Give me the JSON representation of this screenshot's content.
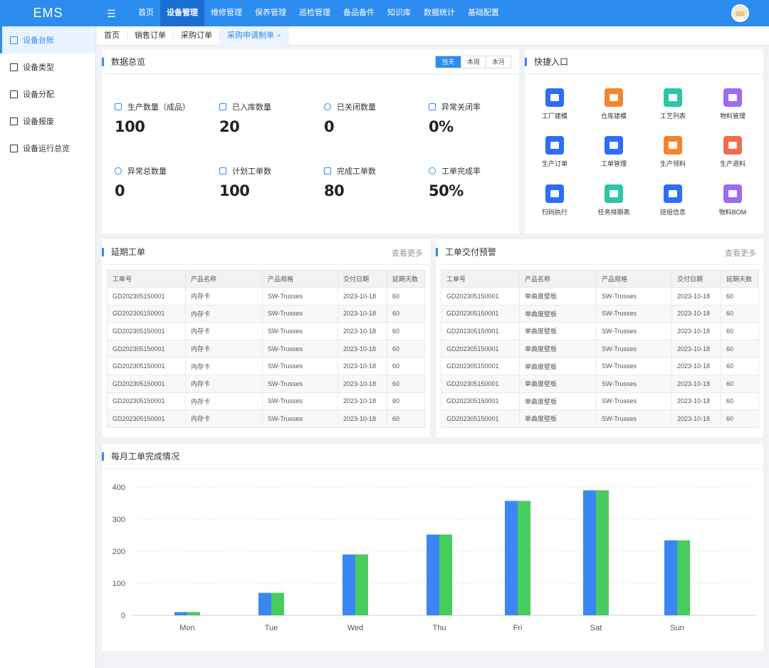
{
  "app": {
    "logo": "EMS"
  },
  "nav": [
    "首页",
    "设备管理",
    "维修管理",
    "保养管理",
    "巡检管理",
    "备品备件",
    "知识库",
    "数据统计",
    "基础配置"
  ],
  "sidebar": [
    "设备台账",
    "设备类型",
    "设备分配",
    "设备报废",
    "设备运行总览"
  ],
  "tabs": [
    {
      "label": "首页",
      "closable": false
    },
    {
      "label": "销售订单",
      "closable": false
    },
    {
      "label": "采购订单",
      "closable": false
    },
    {
      "label": "采购申请制单",
      "closable": true,
      "close": "×"
    }
  ],
  "overview": {
    "title": "数据总览",
    "ranges": [
      "当天",
      "本周",
      "本月"
    ],
    "stats": [
      {
        "label": "生产数量（成品）",
        "value": "100",
        "icon": "database-icon"
      },
      {
        "label": "已入库数量",
        "value": "20",
        "icon": "inbox-icon"
      },
      {
        "label": "已关闭数量",
        "value": "0",
        "icon": "close-circle-icon"
      },
      {
        "label": "异常关闭率",
        "value": "0%",
        "icon": "warning-icon"
      },
      {
        "label": "异常总数量",
        "value": "0",
        "icon": "bug-icon"
      },
      {
        "label": "计划工单数",
        "value": "100",
        "icon": "file-list-icon"
      },
      {
        "label": "完成工单数",
        "value": "80",
        "icon": "file-done-icon"
      },
      {
        "label": "工单完成率",
        "value": "50%",
        "icon": "check-circle-icon"
      }
    ]
  },
  "quick": {
    "title": "快捷入口",
    "items": [
      {
        "label": "工厂建模",
        "color": "#2d6ef5"
      },
      {
        "label": "仓库建模",
        "color": "#f5852d"
      },
      {
        "label": "工艺列表",
        "color": "#2ec4a8"
      },
      {
        "label": "物料管理",
        "color": "#9b6cf0"
      },
      {
        "label": "生产订单",
        "color": "#2d6ef5"
      },
      {
        "label": "工单管理",
        "color": "#2d6ef5"
      },
      {
        "label": "生产领料",
        "color": "#f5852d"
      },
      {
        "label": "生产退料",
        "color": "#f56a4d"
      },
      {
        "label": "扫码执行",
        "color": "#2d6ef5"
      },
      {
        "label": "任务排期表",
        "color": "#2ec4a8"
      },
      {
        "label": "班组信息",
        "color": "#2d6ef5"
      },
      {
        "label": "物料BOM",
        "color": "#9b6cf0"
      }
    ]
  },
  "delay": {
    "title": "延期工单",
    "more": "查看更多",
    "columns": [
      "工单号",
      "产品名称",
      "产品规格",
      "交付日期",
      "延期天数"
    ],
    "rows": [
      [
        "GD202305150001",
        "内存卡",
        "SW-Trusses",
        "2023-10-18",
        "60"
      ],
      [
        "GD202305150001",
        "内存卡",
        "SW-Trusses",
        "2023-10-18",
        "60"
      ],
      [
        "GD202305150001",
        "内存卡",
        "SW-Trusses",
        "2023-10-18",
        "60"
      ],
      [
        "GD202305150001",
        "内存卡",
        "SW-Trusses",
        "2023-10-18",
        "60"
      ],
      [
        "GD202305150001",
        "内存卡",
        "SW-Trusses",
        "2023-10-18",
        "60"
      ],
      [
        "GD202305150001",
        "内存卡",
        "SW-Trusses",
        "2023-10-18",
        "60"
      ],
      [
        "GD202305150001",
        "内存卡",
        "SW-Trusses",
        "2023-10-18",
        "60"
      ],
      [
        "GD202305150001",
        "内存卡",
        "SW-Trusses",
        "2023-10-18",
        "60"
      ]
    ]
  },
  "warning": {
    "title": "工单交付预警",
    "more": "查看更多",
    "columns": [
      "工单号",
      "产品名称",
      "产品规格",
      "交付日期",
      "延期天数"
    ],
    "rows": [
      [
        "GD202305150001",
        "单曲度壁板",
        "SW-Trusses",
        "2023-10-18",
        "60"
      ],
      [
        "GD202305150001",
        "单曲度壁板",
        "SW-Trusses",
        "2023-10-18",
        "60"
      ],
      [
        "GD202305150001",
        "单曲度壁板",
        "SW-Trusses",
        "2023-10-18",
        "60"
      ],
      [
        "GD202305150001",
        "单曲度壁板",
        "SW-Trusses",
        "2023-10-18",
        "60"
      ],
      [
        "GD202305150001",
        "单曲度壁板",
        "SW-Trusses",
        "2023-10-18",
        "60"
      ],
      [
        "GD202305150001",
        "单曲度壁板",
        "SW-Trusses",
        "2023-10-18",
        "60"
      ],
      [
        "GD202305150001",
        "单曲度壁板",
        "SW-Trusses",
        "2023-10-18",
        "60"
      ],
      [
        "GD202305150001",
        "单曲度壁板",
        "SW-Trusses",
        "2023-10-18",
        "60"
      ]
    ]
  },
  "monthly": {
    "title": "每月工单完成情况"
  },
  "chart_data": {
    "type": "bar",
    "title": "每月工单完成情况",
    "categories": [
      "Mon",
      "Tue",
      "Wed",
      "Thu",
      "Fri",
      "Sat",
      "Sun"
    ],
    "series": [
      {
        "values": [
          10,
          70,
          190,
          252,
          357,
          390,
          234
        ],
        "color": "#3a86f5"
      },
      {
        "values": [
          10,
          70,
          190,
          252,
          357,
          390,
          234
        ],
        "color": "#47cc5e"
      }
    ],
    "yticks": [
      0,
      100,
      200,
      300,
      400
    ],
    "ylim": [
      0,
      400
    ],
    "grid": true
  }
}
